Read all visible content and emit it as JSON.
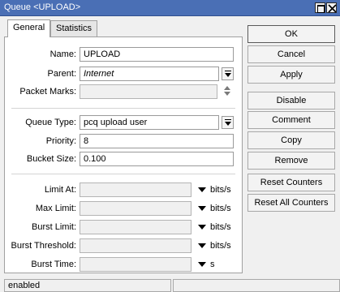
{
  "window": {
    "title": "Queue <UPLOAD>"
  },
  "tabs": [
    {
      "label": "General"
    },
    {
      "label": "Statistics"
    }
  ],
  "form": {
    "name": {
      "label": "Name:",
      "value": "UPLOAD"
    },
    "parent": {
      "label": "Parent:",
      "value": "Internet"
    },
    "packet_marks": {
      "label": "Packet Marks:",
      "value": ""
    },
    "queue_type": {
      "label": "Queue Type:",
      "value": "pcq upload user"
    },
    "priority": {
      "label": "Priority:",
      "value": "8"
    },
    "bucket_size": {
      "label": "Bucket Size:",
      "value": "0.100"
    },
    "limit_at": {
      "label": "Limit At:",
      "value": "",
      "unit": "bits/s"
    },
    "max_limit": {
      "label": "Max Limit:",
      "value": "",
      "unit": "bits/s"
    },
    "burst_limit": {
      "label": "Burst Limit:",
      "value": "",
      "unit": "bits/s"
    },
    "burst_threshold": {
      "label": "Burst Threshold:",
      "value": "",
      "unit": "bits/s"
    },
    "burst_time": {
      "label": "Burst Time:",
      "value": "",
      "unit": "s"
    }
  },
  "buttons": {
    "ok": "OK",
    "cancel": "Cancel",
    "apply": "Apply",
    "disable": "Disable",
    "comment": "Comment",
    "copy": "Copy",
    "remove": "Remove",
    "reset_counters": "Reset Counters",
    "reset_all_counters": "Reset All Counters"
  },
  "status": {
    "text": "enabled",
    "right": ""
  },
  "icons": {
    "maximize": "maximize-icon",
    "close": "close-icon",
    "dropdown": "dropdown-arrow-icon",
    "updown": "up-down-arrow-icon",
    "expand": "expand-triangle-icon"
  },
  "colors": {
    "titlebar": "#4a6fb5",
    "panel": "#ffffff",
    "window": "#f0f0f0"
  }
}
